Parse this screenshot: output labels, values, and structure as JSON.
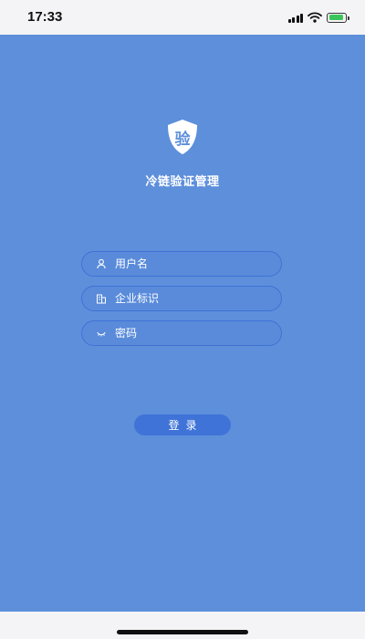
{
  "status_bar": {
    "time": "17:33",
    "icons": [
      "signal-icon",
      "wifi-icon",
      "battery-charging-icon"
    ],
    "battery_level": 0.9,
    "battery_color": "#3bc45c"
  },
  "app": {
    "logo_char": "验",
    "logo_icon": "shield-icon",
    "title": "冷链验证管理",
    "background_color": "#5d8fdb",
    "accent_color": "#3f73d8"
  },
  "form": {
    "username": {
      "icon": "user-icon",
      "placeholder": "用户名",
      "value": ""
    },
    "company": {
      "icon": "building-icon",
      "placeholder": "企业标识",
      "value": ""
    },
    "password": {
      "icon": "eye-closed-icon",
      "placeholder": "密码",
      "value": ""
    },
    "login_label": "登录"
  }
}
